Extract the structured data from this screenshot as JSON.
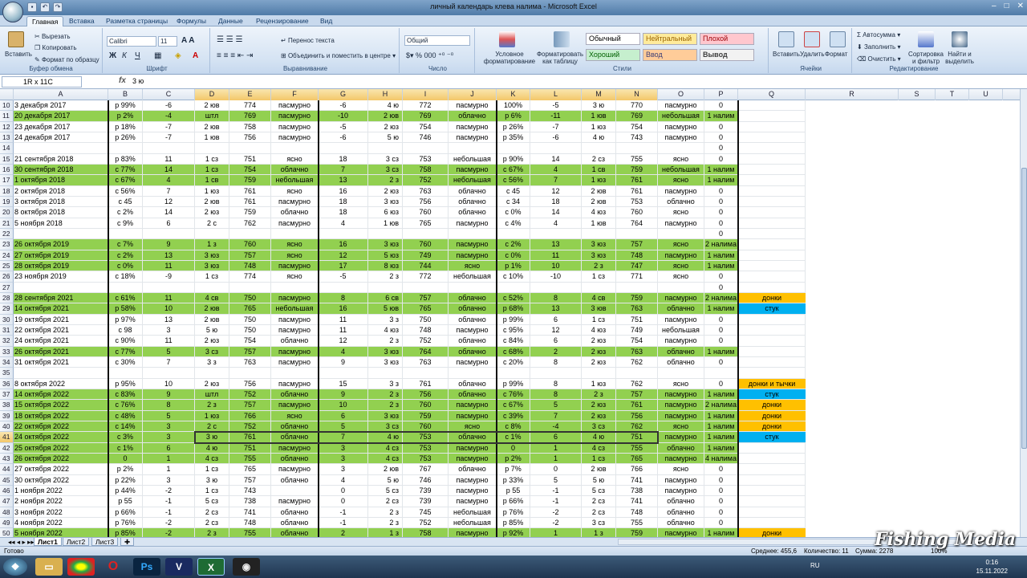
{
  "window": {
    "title": "личный календарь клева налима - Microsoft Excel"
  },
  "tabs": [
    "Главная",
    "Вставка",
    "Разметка страницы",
    "Формулы",
    "Данные",
    "Рецензирование",
    "Вид"
  ],
  "ribbon": {
    "clipboard": {
      "label": "Буфер обмена",
      "paste": "Вставить",
      "cut": "Вырезать",
      "copy": "Копировать",
      "format_painter": "Формат по образцу"
    },
    "font": {
      "label": "Шрифт",
      "name": "Calibri",
      "size": "11"
    },
    "alignment": {
      "label": "Выравнивание",
      "wrap": "Перенос текста",
      "merge": "Объединить и поместить в центре"
    },
    "number": {
      "label": "Число",
      "format": "Общий"
    },
    "styles": {
      "label": "Стили",
      "conditional": "Условное форматирование",
      "as_table": "Форматировать как таблицу",
      "normal": "Обычный",
      "neutral": "Нейтральный",
      "bad": "Плохой",
      "good": "Хороший",
      "input": "Ввод",
      "output": "Вывод"
    },
    "cells": {
      "label": "Ячейки",
      "insert": "Вставить",
      "delete": "Удалить",
      "format": "Формат"
    },
    "editing": {
      "label": "Редактирование",
      "autosum": "Автосумма",
      "fill": "Заполнить",
      "clear": "Очистить",
      "sort": "Сортировка и фильтр",
      "find": "Найти и выделить"
    }
  },
  "formula_bar": {
    "name_box": "1R x 11C",
    "content": "3 ю"
  },
  "columns": [
    "A",
    "B",
    "C",
    "D",
    "E",
    "F",
    "G",
    "H",
    "I",
    "J",
    "K",
    "L",
    "M",
    "N",
    "O",
    "P",
    "Q",
    "R",
    "S",
    "T",
    "U"
  ],
  "rows": [
    {
      "n": "10",
      "g": 0,
      "c": [
        "3 декабря 2017",
        "р 99%",
        "-6",
        "2 юв",
        "774",
        "пасмурно",
        "-6",
        "4 ю",
        "772",
        "пасмурно",
        "100%",
        "-5",
        "3 ю",
        "770",
        "пасмурно",
        "0",
        ""
      ]
    },
    {
      "n": "11",
      "g": 1,
      "c": [
        "20 декабря 2017",
        "р 2%",
        "-4",
        "штл",
        "769",
        "пасмурно",
        "-10",
        "2 юв",
        "769",
        "облачно",
        "р 6%",
        "-11",
        "1 юв",
        "769",
        "небольшая",
        "1 налим",
        ""
      ]
    },
    {
      "n": "12",
      "g": 0,
      "c": [
        "23 декабря 2017",
        "р 18%",
        "-7",
        "2 юв",
        "758",
        "пасмурно",
        "-5",
        "2 юз",
        "754",
        "пасмурно",
        "р 26%",
        "-7",
        "1 юз",
        "754",
        "пасмурно",
        "0",
        ""
      ]
    },
    {
      "n": "13",
      "g": 0,
      "c": [
        "24 декабря 2017",
        "р 26%",
        "-7",
        "1 юв",
        "756",
        "пасмурно",
        "-6",
        "5 ю",
        "746",
        "пасмурно",
        "р 35%",
        "-6",
        "4 ю",
        "743",
        "пасмурно",
        "0",
        ""
      ]
    },
    {
      "n": "14",
      "g": 0,
      "c": [
        "",
        "",
        "",
        "",
        "",
        "",
        "",
        "",
        "",
        "",
        "",
        "",
        "",
        "",
        "",
        "0",
        ""
      ]
    },
    {
      "n": "15",
      "g": 0,
      "c": [
        "21 сентября 2018",
        "р 83%",
        "11",
        "1 сз",
        "751",
        "ясно",
        "18",
        "3 сз",
        "753",
        "небольшая",
        "р 90%",
        "14",
        "2 сз",
        "755",
        "ясно",
        "0",
        ""
      ]
    },
    {
      "n": "16",
      "g": 1,
      "c": [
        "30 сентября 2018",
        "с 77%",
        "14",
        "1 сз",
        "754",
        "облачно",
        "7",
        "3 сз",
        "758",
        "пасмурно",
        "с 67%",
        "4",
        "1 св",
        "759",
        "небольшая",
        "1 налим",
        ""
      ]
    },
    {
      "n": "17",
      "g": 1,
      "c": [
        "1 октября 2018",
        "с 67%",
        "4",
        "1 св",
        "759",
        "небольшая",
        "13",
        "2 з",
        "752",
        "небольшая",
        "с 56%",
        "7",
        "1 юз",
        "761",
        "ясно",
        "1 налим",
        ""
      ]
    },
    {
      "n": "18",
      "g": 0,
      "c": [
        "2 октября 2018",
        "с 56%",
        "7",
        "1 юз",
        "761",
        "ясно",
        "16",
        "2 юз",
        "763",
        "облачно",
        "с 45",
        "12",
        "2 юв",
        "761",
        "пасмурно",
        "0",
        ""
      ]
    },
    {
      "n": "19",
      "g": 0,
      "c": [
        "3 октября 2018",
        "с 45",
        "12",
        "2 юв",
        "761",
        "пасмурно",
        "18",
        "3 юз",
        "756",
        "облачно",
        "с 34",
        "18",
        "2 юв",
        "753",
        "облачно",
        "0",
        ""
      ]
    },
    {
      "n": "20",
      "g": 0,
      "c": [
        "8 октября 2018",
        "с 2%",
        "14",
        "2 юз",
        "759",
        "облачно",
        "18",
        "6 юз",
        "760",
        "облачно",
        "с 0%",
        "14",
        "4 юз",
        "760",
        "ясно",
        "0",
        ""
      ]
    },
    {
      "n": "21",
      "g": 0,
      "c": [
        "5 ноября 2018",
        "с 9%",
        "6",
        "2 с",
        "762",
        "пасмурно",
        "4",
        "1 юв",
        "765",
        "пасмурно",
        "с 4%",
        "4",
        "1 юв",
        "764",
        "пасмурно",
        "0",
        ""
      ]
    },
    {
      "n": "22",
      "g": 0,
      "c": [
        "",
        "",
        "",
        "",
        "",
        "",
        "",
        "",
        "",
        "",
        "",
        "",
        "",
        "",
        "",
        "0",
        ""
      ]
    },
    {
      "n": "23",
      "g": 1,
      "c": [
        "26 октября 2019",
        "с 7%",
        "9",
        "1 з",
        "760",
        "ясно",
        "16",
        "3 юз",
        "760",
        "пасмурно",
        "с 2%",
        "13",
        "3 юз",
        "757",
        "ясно",
        "2 налима",
        ""
      ]
    },
    {
      "n": "24",
      "g": 1,
      "c": [
        "27 октября 2019",
        "с 2%",
        "13",
        "3 юз",
        "757",
        "ясно",
        "12",
        "5 юз",
        "749",
        "пасмурно",
        "с 0%",
        "11",
        "3 юз",
        "748",
        "пасмурно",
        "1 налим",
        ""
      ]
    },
    {
      "n": "25",
      "g": 1,
      "c": [
        "28 октября 2019",
        "с 0%",
        "11",
        "3 юз",
        "748",
        "пасмурно",
        "17",
        "8 юз",
        "744",
        "ясно",
        "р 1%",
        "10",
        "2 з",
        "747",
        "ясно",
        "1 налим",
        ""
      ]
    },
    {
      "n": "26",
      "g": 0,
      "c": [
        "23 ноября 2019",
        "с 18%",
        "-9",
        "1 сз",
        "774",
        "ясно",
        "-5",
        "2 з",
        "772",
        "небольшая",
        "с 10%",
        "-10",
        "1 сз",
        "771",
        "ясно",
        "0",
        ""
      ]
    },
    {
      "n": "27",
      "g": 0,
      "c": [
        "",
        "",
        "",
        "",
        "",
        "",
        "",
        "",
        "",
        "",
        "",
        "",
        "",
        "",
        "",
        "0",
        ""
      ]
    },
    {
      "n": "28",
      "g": 1,
      "c": [
        "28 сентября 2021",
        "с 61%",
        "11",
        "4 св",
        "750",
        "пасмурно",
        "8",
        "6 св",
        "757",
        "облачно",
        "с 52%",
        "8",
        "4 св",
        "759",
        "пасмурно",
        "2 налима",
        "донки"
      ],
      "q": "o"
    },
    {
      "n": "29",
      "g": 1,
      "c": [
        "14 октября 2021",
        "р 58%",
        "10",
        "2 юв",
        "765",
        "небольшая",
        "16",
        "5 юв",
        "765",
        "облачно",
        "р 68%",
        "13",
        "3 юв",
        "763",
        "облачно",
        "1 налим",
        "стук"
      ],
      "q": "b"
    },
    {
      "n": "30",
      "g": 0,
      "c": [
        "19 октября 2021",
        "р 97%",
        "13",
        "2 юв",
        "750",
        "пасмурно",
        "11",
        "3 з",
        "750",
        "облачно",
        "р 99%",
        "6",
        "1 сз",
        "751",
        "пасмурно",
        "0",
        ""
      ]
    },
    {
      "n": "31",
      "g": 0,
      "c": [
        "22 октября 2021",
        "с 98",
        "3",
        "5 ю",
        "750",
        "пасмурно",
        "11",
        "4 юз",
        "748",
        "пасмурно",
        "с 95%",
        "12",
        "4 юз",
        "749",
        "небольшая",
        "0",
        ""
      ]
    },
    {
      "n": "32",
      "g": 0,
      "c": [
        "24 октября 2021",
        "с 90%",
        "11",
        "2 юз",
        "754",
        "облачно",
        "12",
        "2 з",
        "752",
        "облачно",
        "с 84%",
        "6",
        "2 юз",
        "754",
        "пасмурно",
        "0",
        ""
      ]
    },
    {
      "n": "33",
      "g": 1,
      "c": [
        "26 октября 2021",
        "с 77%",
        "5",
        "3 сз",
        "757",
        "пасмурно",
        "4",
        "3 юз",
        "764",
        "облачно",
        "с 68%",
        "2",
        "2 юз",
        "763",
        "облачно",
        "1 налим",
        ""
      ]
    },
    {
      "n": "34",
      "g": 0,
      "c": [
        "31 октября 2021",
        "с 30%",
        "7",
        "3 з",
        "763",
        "пасмурно",
        "9",
        "3 юз",
        "763",
        "пасмурно",
        "с 20%",
        "8",
        "2 юз",
        "762",
        "облачно",
        "0",
        ""
      ]
    },
    {
      "n": "35",
      "g": 0,
      "c": [
        "",
        "",
        "",
        "",
        "",
        "",
        "",
        "",
        "",
        "",
        "",
        "",
        "",
        "",
        "",
        "",
        ""
      ]
    },
    {
      "n": "36",
      "g": 0,
      "c": [
        "8 октября 2022",
        "р 95%",
        "10",
        "2 юз",
        "756",
        "пасмурно",
        "15",
        "3 з",
        "761",
        "облачно",
        "р 99%",
        "8",
        "1 юз",
        "762",
        "ясно",
        "0",
        "донки и тычки"
      ],
      "q": "o"
    },
    {
      "n": "37",
      "g": 1,
      "c": [
        "14 октября 2022",
        "с 83%",
        "9",
        "штл",
        "752",
        "облачно",
        "9",
        "2 з",
        "756",
        "облачно",
        "с 76%",
        "8",
        "2 з",
        "757",
        "пасмурно",
        "1 налим",
        "стук"
      ],
      "q": "b"
    },
    {
      "n": "38",
      "g": 1,
      "c": [
        "15 октября 2022",
        "с 76%",
        "8",
        "2 з",
        "757",
        "пасмурно",
        "10",
        "2 з",
        "760",
        "пасмурно",
        "с 67%",
        "5",
        "2 юз",
        "761",
        "пасмурно",
        "2 налима",
        "донки"
      ],
      "q": "o"
    },
    {
      "n": "39",
      "g": 1,
      "c": [
        "18 октября 2022",
        "с 48%",
        "5",
        "1 юз",
        "766",
        "ясно",
        "6",
        "3 юз",
        "759",
        "пасмурно",
        "с 39%",
        "7",
        "2 юз",
        "756",
        "пасмурно",
        "1 налим",
        "донки"
      ],
      "q": "o"
    },
    {
      "n": "40",
      "g": 1,
      "c": [
        "22 октября 2022",
        "с 14%",
        "3",
        "2 с",
        "752",
        "облачно",
        "5",
        "3 сз",
        "760",
        "ясно",
        "с 8%",
        "-4",
        "3 сз",
        "762",
        "ясно",
        "1 налим",
        "донки"
      ],
      "q": "o"
    },
    {
      "n": "41",
      "g": 1,
      "sel": 1,
      "c": [
        "24 октября 2022",
        "с 3%",
        "3",
        "3 ю",
        "761",
        "облачно",
        "7",
        "4 ю",
        "753",
        "облачно",
        "с 1%",
        "6",
        "4 ю",
        "751",
        "пасмурно",
        "1 налим",
        "стук"
      ],
      "q": "b"
    },
    {
      "n": "42",
      "g": 1,
      "c": [
        "25 октября 2022",
        "с 1%",
        "6",
        "4 ю",
        "751",
        "пасмурно",
        "3",
        "4 сз",
        "753",
        "пасмурно",
        "0",
        "1",
        "4 сз",
        "755",
        "облачно",
        "1 налим",
        ""
      ]
    },
    {
      "n": "43",
      "g": 1,
      "c": [
        "26 октября 2022",
        "0",
        "1",
        "4 сз",
        "755",
        "облачно",
        "3",
        "4 сз",
        "753",
        "пасмурно",
        "р 2%",
        "1",
        "1 сз",
        "765",
        "пасмурно",
        "4 налима",
        ""
      ]
    },
    {
      "n": "44",
      "g": 0,
      "c": [
        "27 октября 2022",
        "р 2%",
        "1",
        "1 сз",
        "765",
        "пасмурно",
        "3",
        "2 юв",
        "767",
        "облачно",
        "р 7%",
        "0",
        "2 юв",
        "766",
        "ясно",
        "0",
        ""
      ]
    },
    {
      "n": "45",
      "g": 0,
      "c": [
        "30 октября 2022",
        "р 22%",
        "3",
        "3 ю",
        "757",
        "облачно",
        "4",
        "5 ю",
        "746",
        "пасмурно",
        "р 33%",
        "5",
        "5 ю",
        "741",
        "пасмурно",
        "0",
        ""
      ]
    },
    {
      "n": "46",
      "g": 0,
      "c": [
        "1 ноября 2022",
        "р 44%",
        "-2",
        "1 сз",
        "743",
        "",
        "0",
        "5 сз",
        "739",
        "пасмурно",
        "р 55",
        "-1",
        "5 сз",
        "738",
        "пасмурно",
        "0",
        ""
      ]
    },
    {
      "n": "47",
      "g": 0,
      "c": [
        "2 ноября 2022",
        "р 55",
        "-1",
        "5 сз",
        "738",
        "пасмурно",
        "0",
        "2 сз",
        "739",
        "пасмурно",
        "р 66%",
        "-1",
        "2 сз",
        "741",
        "облачно",
        "0",
        ""
      ]
    },
    {
      "n": "48",
      "g": 0,
      "c": [
        "3 ноября 2022",
        "р 66%",
        "-1",
        "2 сз",
        "741",
        "облачно",
        "-1",
        "2 з",
        "745",
        "небольшая",
        "р 76%",
        "-2",
        "2 сз",
        "748",
        "облачно",
        "0",
        ""
      ]
    },
    {
      "n": "49",
      "g": 0,
      "c": [
        "4 ноября 2022",
        "р 76%",
        "-2",
        "2 сз",
        "748",
        "облачно",
        "-1",
        "2 з",
        "752",
        "небольшая",
        "р 85%",
        "-2",
        "3 сз",
        "755",
        "облачно",
        "0",
        ""
      ]
    },
    {
      "n": "50",
      "g": 1,
      "c": [
        "5 ноября 2022",
        "р 85%",
        "-2",
        "2 з",
        "755",
        "облачно",
        "2",
        "1 з",
        "758",
        "пасмурно",
        "р 92%",
        "1",
        "1 з",
        "759",
        "пасмурно",
        "1 налим",
        "донки"
      ],
      "q": "o"
    }
  ],
  "sheet_tabs": [
    "Лист1",
    "Лист2",
    "Лист3"
  ],
  "status": {
    "ready": "Готово",
    "average": "Среднее: 455,6",
    "count": "Количество: 11",
    "sum": "Сумма: 2278",
    "zoom": "100%"
  },
  "taskbar": {
    "lang": "RU",
    "time": "0:16",
    "date": "15.11.2022"
  },
  "watermark": "Fishing Media",
  "colors": {
    "green": "#92d050",
    "orange": "#ffc000",
    "blue": "#00b0f0"
  }
}
